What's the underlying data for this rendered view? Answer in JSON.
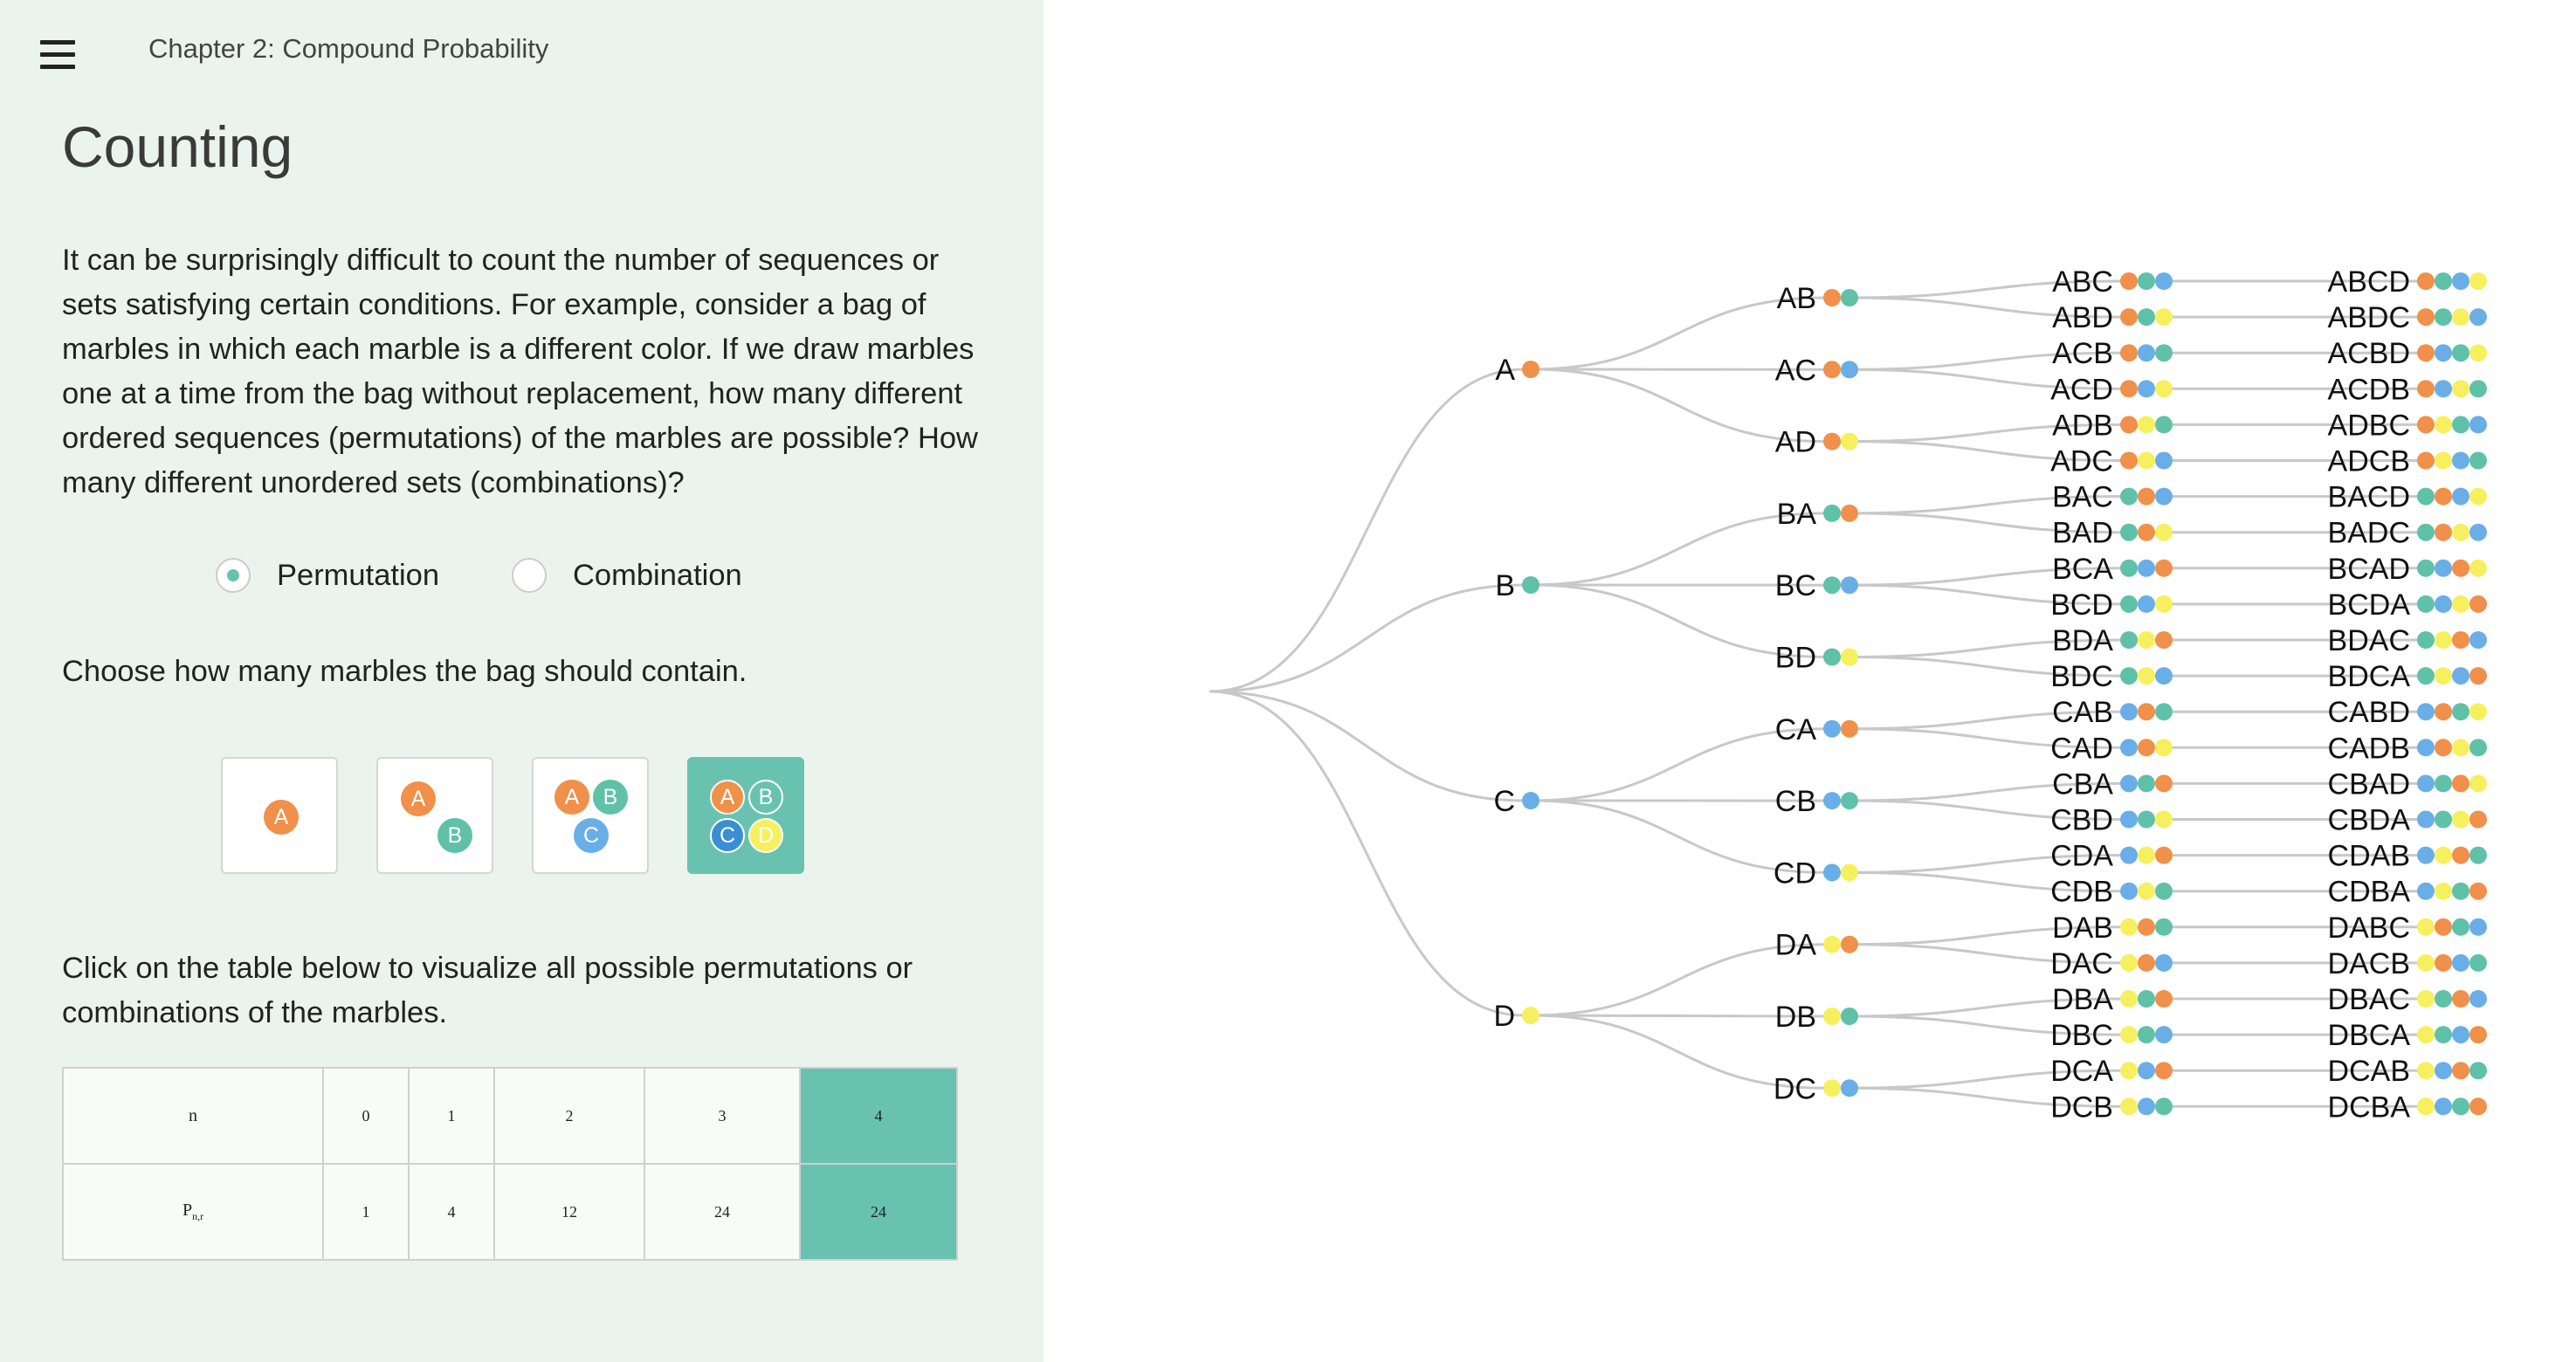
{
  "header": {
    "breadcrumb": "Chapter 2: Compound Probability"
  },
  "page_title": "Counting",
  "intro_text": "It can be surprisingly difficult to count the number of sequences or sets satisfying certain conditions. For example, consider a bag of marbles in which each marble is a different color. If we draw marbles one at a time from the bag without replacement, how many different ordered sequences (permutations) of the marbles are possible? How many different unordered sets (combinations)?",
  "mode_options": [
    {
      "label": "Permutation",
      "selected": true
    },
    {
      "label": "Combination",
      "selected": false
    }
  ],
  "choose_text": "Choose how many marbles the bag should contain.",
  "marble_colors": {
    "A": "#f0904a",
    "B": "#5fc1a8",
    "C": "#6aaee8",
    "D": "#f7f05e"
  },
  "marble_count_options": [
    {
      "count": 1,
      "letters": [
        "A"
      ]
    },
    {
      "count": 2,
      "letters": [
        "A",
        "B"
      ]
    },
    {
      "count": 3,
      "letters": [
        "A",
        "B",
        "C"
      ]
    },
    {
      "count": 4,
      "letters": [
        "A",
        "B",
        "C",
        "D"
      ]
    }
  ],
  "selected_marble_count": 4,
  "click_text": "Click on the table below to visualize all possible permutations or combinations of the marbles.",
  "table": {
    "row1_label": "n",
    "row2_label": "P",
    "row2_label_sub": "n,r",
    "n_values": [
      "0",
      "1",
      "2",
      "3",
      "4"
    ],
    "p_values": [
      "1",
      "4",
      "12",
      "24",
      "24"
    ],
    "highlighted_index": 4
  },
  "tree": {
    "level1": [
      "A",
      "B",
      "C",
      "D"
    ],
    "level2": [
      "AB",
      "AC",
      "AD",
      "BA",
      "BC",
      "BD",
      "CA",
      "CB",
      "CD",
      "DA",
      "DB",
      "DC"
    ],
    "level3": [
      "ABC",
      "ABD",
      "ACB",
      "ACD",
      "ADB",
      "ADC",
      "BAC",
      "BAD",
      "BCA",
      "BCD",
      "BDA",
      "BDC",
      "CAB",
      "CAD",
      "CBA",
      "CBD",
      "CDA",
      "CDB",
      "DAB",
      "DAC",
      "DBA",
      "DBC",
      "DCA",
      "DCB"
    ],
    "level4": [
      "ABCD",
      "ABDC",
      "ACBD",
      "ACDB",
      "ADBC",
      "ADCB",
      "BACD",
      "BADC",
      "BCAD",
      "BCDA",
      "BDAC",
      "BDCA",
      "CABD",
      "CADB",
      "CBAD",
      "CBDA",
      "CDAB",
      "CDBA",
      "DABC",
      "DACB",
      "DBAC",
      "DBCA",
      "DCAB",
      "DCBA"
    ]
  }
}
